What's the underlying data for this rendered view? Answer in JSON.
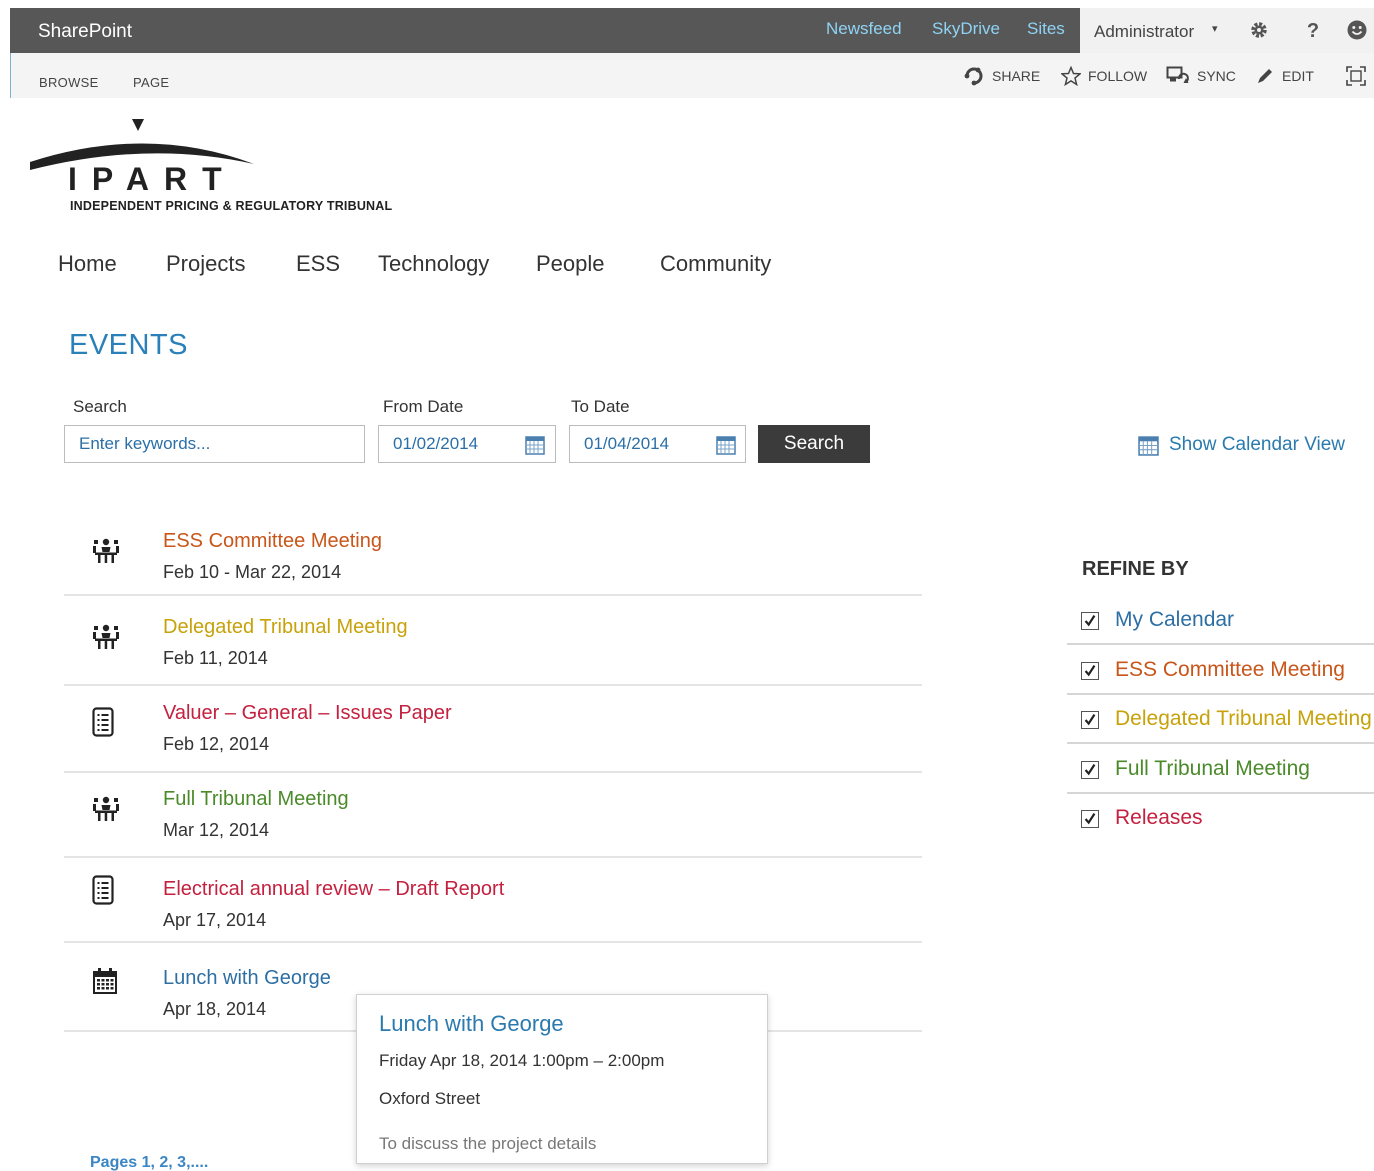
{
  "suite_bar": {
    "brand": "SharePoint",
    "links": [
      "Newsfeed",
      "SkyDrive",
      "Sites"
    ],
    "user": "Administrator",
    "icons": [
      "settings-gear-icon",
      "help-question-icon",
      "user-smiley-icon"
    ]
  },
  "ribbon": {
    "tabs": [
      "BROWSE",
      "PAGE"
    ],
    "actions": [
      {
        "label": "SHARE",
        "icon": "share-icon"
      },
      {
        "label": "FOLLOW",
        "icon": "star-icon"
      },
      {
        "label": "SYNC",
        "icon": "sync-icon"
      },
      {
        "label": "EDIT",
        "icon": "pencil-icon"
      }
    ]
  },
  "logo": {
    "wordmark": "IPART",
    "subtitle": "INDEPENDENT PRICING & REGULATORY TRIBUNAL"
  },
  "nav": [
    "Home",
    "Projects",
    "ESS",
    "Technology",
    "People",
    "Community"
  ],
  "page_title": "EVENTS",
  "search": {
    "search_label": "Search",
    "search_placeholder": "Enter keywords...",
    "from_label": "From Date",
    "from_value": "01/02/2014",
    "to_label": "To Date",
    "to_value": "01/04/2014",
    "button": "Search",
    "calendar_view": "Show Calendar View"
  },
  "events": [
    {
      "title": "ESS Committee Meeting",
      "date": "Feb 10 - Mar 22, 2014",
      "color": "#c8561a",
      "icon": "meeting-icon"
    },
    {
      "title": "Delegated Tribunal Meeting",
      "date": "Feb 11, 2014",
      "color": "#c7a20a",
      "icon": "meeting-icon"
    },
    {
      "title": "Valuer – General – Issues Paper",
      "date": "Feb 12, 2014",
      "color": "#c4203f",
      "icon": "document-icon"
    },
    {
      "title": "Full Tribunal Meeting",
      "date": "Mar 12, 2014",
      "color": "#4b8a2a",
      "icon": "meeting-icon"
    },
    {
      "title": "Electrical annual review – Draft Report",
      "date": "Apr 17, 2014",
      "color": "#c4203f",
      "icon": "document-icon"
    },
    {
      "title": "Lunch with George",
      "date": "Apr 18, 2014",
      "color": "#2d6ea3",
      "icon": "calendar-icon"
    }
  ],
  "refine": {
    "title": "REFINE BY",
    "items": [
      {
        "label": "My Calendar",
        "color": "#2d6ea3",
        "checked": true
      },
      {
        "label": "ESS Committee Meeting",
        "color": "#c8561a",
        "checked": true
      },
      {
        "label": "Delegated Tribunal Meeting",
        "color": "#c7a20a",
        "checked": true
      },
      {
        "label": "Full Tribunal Meeting",
        "color": "#4b8a2a",
        "checked": true
      },
      {
        "label": "Releases",
        "color": "#c4203f",
        "checked": true
      }
    ]
  },
  "popup": {
    "title": "Lunch with George",
    "when": "Friday Apr 18, 2014 1:00pm – 2:00pm",
    "where": "Oxford Street",
    "description": "To discuss the project details"
  },
  "pager": "Pages 1, 2, 3,...."
}
